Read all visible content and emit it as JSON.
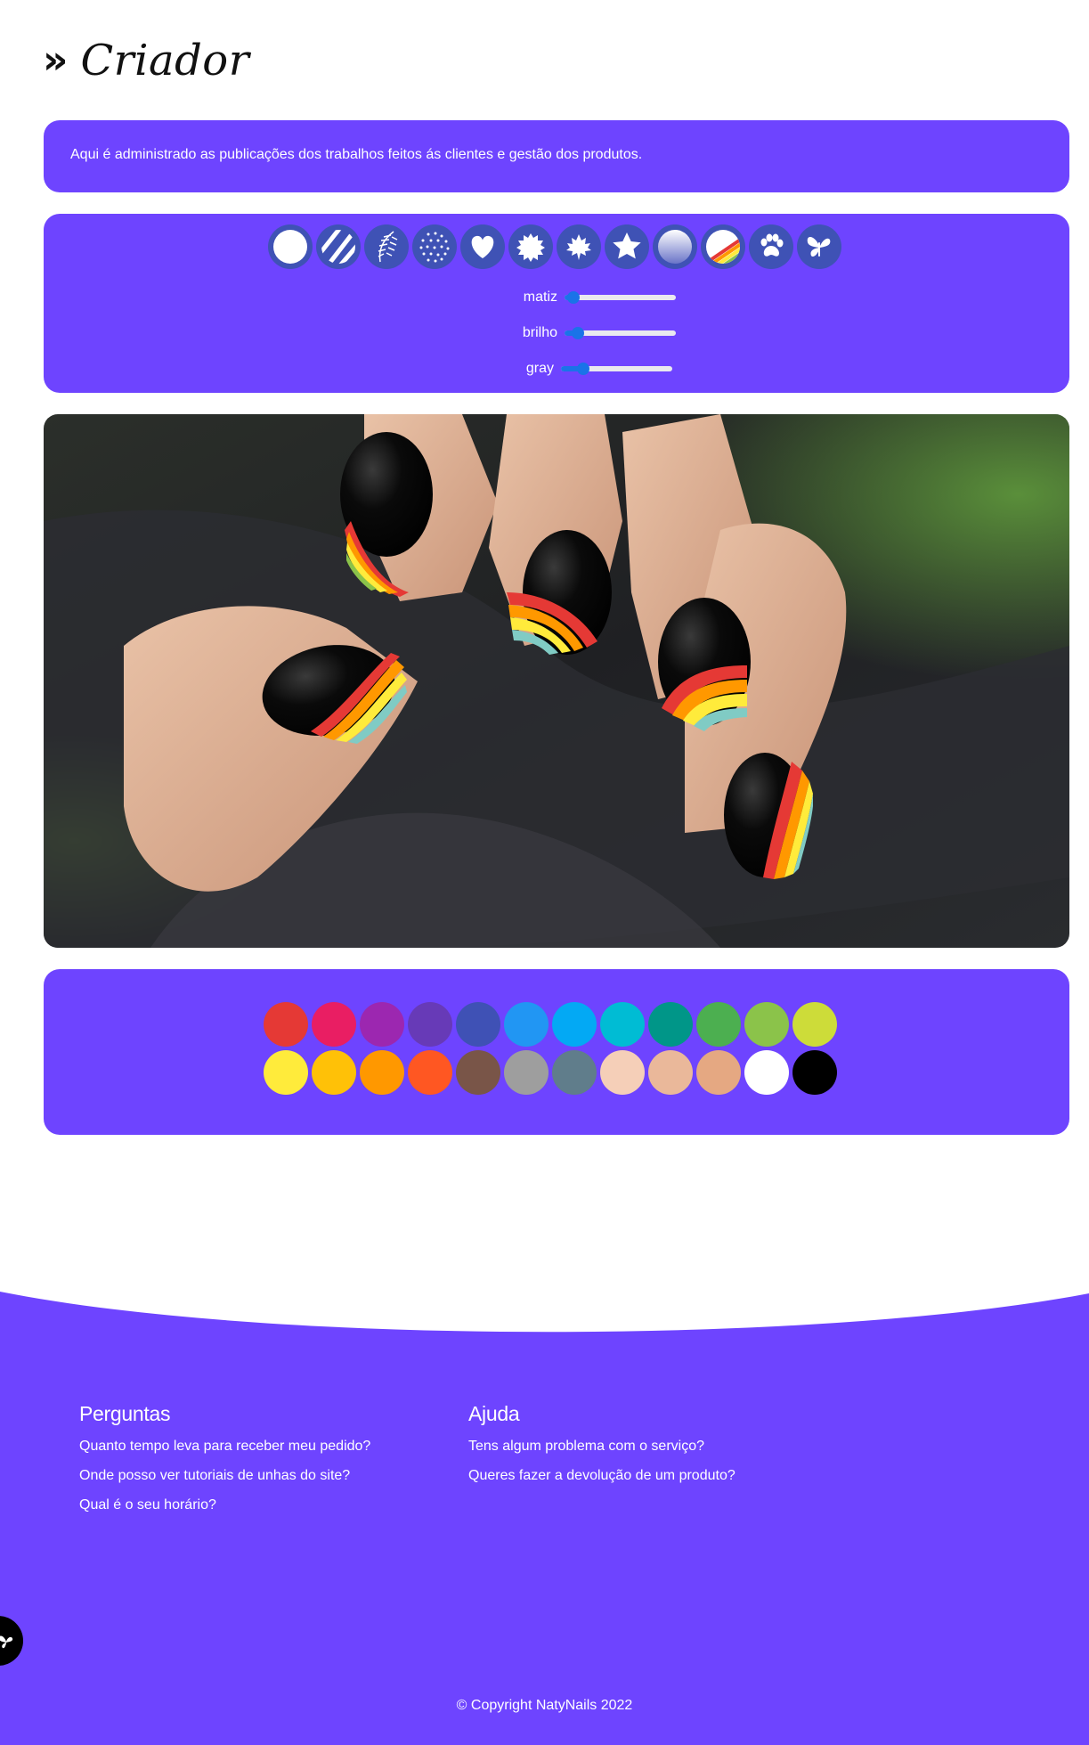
{
  "header": {
    "chevron": "»",
    "title": "Criador"
  },
  "info": {
    "text": "Aqui é administrado as publicações dos trabalhos feitos ás clientes e gestão dos produtos."
  },
  "patterns": [
    {
      "name": "plain-icon"
    },
    {
      "name": "stripes-icon"
    },
    {
      "name": "leaf-icon"
    },
    {
      "name": "dots-icon"
    },
    {
      "name": "heart-icon"
    },
    {
      "name": "burst-icon"
    },
    {
      "name": "maple-leaf-icon"
    },
    {
      "name": "star-icon"
    },
    {
      "name": "gradient-icon"
    },
    {
      "name": "rainbow-icon"
    },
    {
      "name": "paw-icon"
    },
    {
      "name": "butterfly-icon"
    }
  ],
  "sliders": [
    {
      "label": "matiz",
      "value": 0.02
    },
    {
      "label": "brilho",
      "value": 0.06
    },
    {
      "label": "gray",
      "value": 0.14
    }
  ],
  "colors": [
    "#e53935",
    "#e91e63",
    "#9c27b0",
    "#673ab7",
    "#3f51b5",
    "#2196f3",
    "#03a9f4",
    "#00bcd4",
    "#009688",
    "#4caf50",
    "#8bc34a",
    "#cddc39",
    "#ffeb3b",
    "#ffc107",
    "#ff9800",
    "#ff5722",
    "#795548",
    "#9e9e9e",
    "#607d8b",
    "#f5cfb8",
    "#eab89a",
    "#e5a882",
    "#ffffff",
    "#000000"
  ],
  "accent": "#6e44ff",
  "footer": {
    "col1": {
      "title": "Perguntas",
      "links": [
        "Quanto tempo leva para receber meu pedido?",
        "Onde posso ver tutoriais de unhas do site?",
        "Qual é o seu horário?"
      ]
    },
    "col2": {
      "title": "Ajuda",
      "links": [
        "Tens algum problema com o serviço?",
        "Queres fazer a devolução de um produto?"
      ]
    },
    "copyright": "© Copyright NatyNails 2022"
  }
}
